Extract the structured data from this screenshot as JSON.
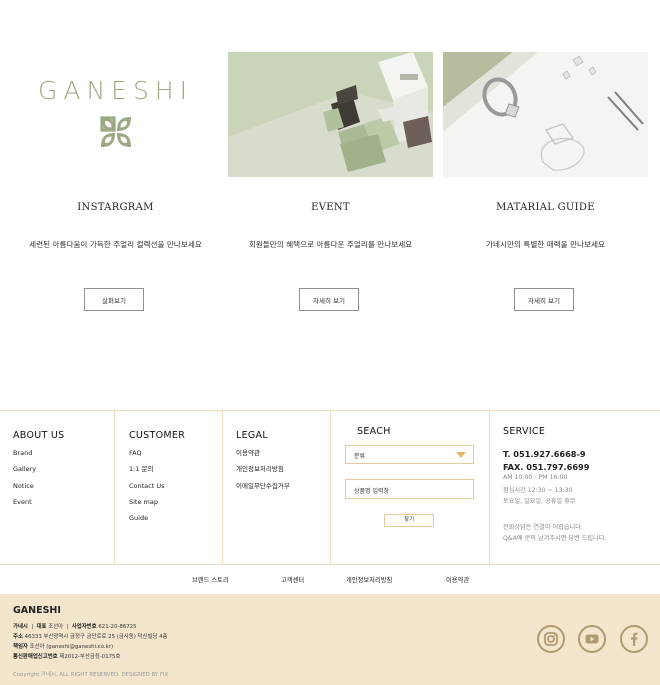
{
  "cards": [
    {
      "title": "INSTARGRAM",
      "desc": "세련된 아름다움이 가득한 주얼리 컬렉션을 만나보세요",
      "button": "살펴보기"
    },
    {
      "title": "EVENT",
      "desc": "회원들만의 혜택으로 아름다운 주얼리를 만나보세요",
      "button": "자세히 보기"
    },
    {
      "title": "MATARIAL GUIDE",
      "desc": "가네시만의 특별한 매력을 만나보세요",
      "button": "자세히 보기"
    }
  ],
  "logo": {
    "word": "GANESHI"
  },
  "footer": {
    "about": {
      "title": "ABOUT US",
      "items": [
        "Brand",
        "Gallery",
        "Notice",
        "Event"
      ]
    },
    "customer": {
      "title": "CUSTOMER",
      "items": [
        "FAQ",
        "1:1 문의",
        "Contact Us",
        "Site map",
        "Guide"
      ]
    },
    "legal": {
      "title": "LEGAL",
      "items": [
        "이용약관",
        "개인정보처리방침",
        "이메일무단수집거부"
      ]
    },
    "search": {
      "title": "SEACH",
      "select_value": "분류",
      "input_placeholder": "상품명 입력창",
      "button": "찾기"
    },
    "service": {
      "title": "SERVICE",
      "tel": "T.  051.927.6668-9",
      "fax": "FAX.  051.797.6699",
      "hours": "AM 10:00 - PM 16:00",
      "lunch": "점심시간 12:30 ~ 13:30",
      "closed": "토요일, 일요일, 공휴일 휴무",
      "notice1": "전화상담은 연결이 어렵습니다.",
      "notice2": "Q&A에 문의 남겨주시면 답변 드립니다."
    }
  },
  "bottom_links": [
    "브랜드 스토리",
    "고객센터",
    "개인정보처리방침",
    "이용약관"
  ],
  "company": {
    "name": "GANESHI",
    "line1_a": "가네시",
    "line1_b": "대표",
    "line1_c": "조선아",
    "line1_d": "사업자번호",
    "line1_e": "621-20-86725",
    "line2_a": "주소",
    "line2_b": "46333 부산광역시 금정구 금단로로 25 (금사동) 덕신빌딩 4층",
    "line3_a": "책임자",
    "line3_b": "조선아 (ganeshi@ganeshi.co.kr)",
    "line4_a": "통신판매업신고번호",
    "line4_b": "제2012-부산금정-0175호",
    "copyright": "Copyright 가네시. ALL RIGHT RESERVED. DESIGNED BY FIX"
  },
  "colors": {
    "accent": "#e8b468",
    "footer_bg": "#f3e6cd",
    "border": "#f0dcc0",
    "logo": "#9aa883",
    "social": "#b09a72"
  },
  "icons": [
    "logo-mark-icon",
    "dropdown-arrow-icon",
    "instagram-icon",
    "youtube-icon",
    "facebook-icon"
  ]
}
